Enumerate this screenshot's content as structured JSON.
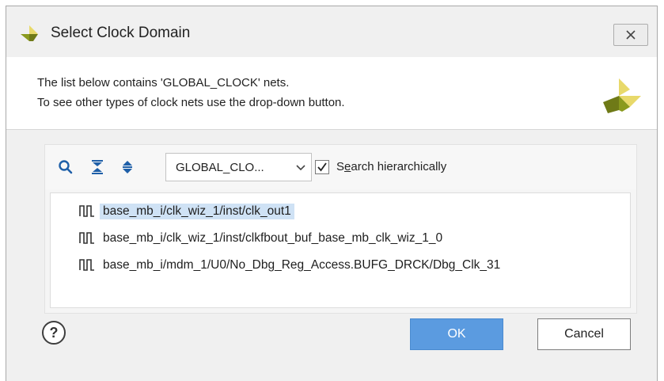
{
  "dialog": {
    "title": "Select Clock Domain",
    "icons": {
      "app": "xilinx-logo-icon",
      "close": "close-icon"
    }
  },
  "header": {
    "line1": "The list below contains 'GLOBAL_CLOCK' nets.",
    "line2": "To see other types of clock nets use the drop-down button.",
    "logo": "xilinx-logo-icon"
  },
  "toolbar": {
    "icons": [
      "search-icon",
      "collapse-all-icon",
      "expand-all-icon"
    ],
    "combo_value": "GLOBAL_CLO...",
    "search_hier": {
      "prefix": "S",
      "mnemonic": "e",
      "rest": "arch hierarchically",
      "checked": true
    }
  },
  "nets": [
    {
      "name": "base_mb_i/clk_wiz_1/inst/clk_out1",
      "selected": true
    },
    {
      "name": "base_mb_i/clk_wiz_1/inst/clkfbout_buf_base_mb_clk_wiz_1_0",
      "selected": false
    },
    {
      "name": "base_mb_i/mdm_1/U0/No_Dbg_Reg_Access.BUFG_DRCK/Dbg_Clk_31",
      "selected": false
    }
  ],
  "footer": {
    "help_label": "?",
    "ok_label": "OK",
    "cancel_label": "Cancel"
  },
  "colors": {
    "accent": "#5b9be0",
    "selection": "#cfe2f5",
    "logo_light": "#e8d96a",
    "logo_dark": "#6f7a17"
  }
}
